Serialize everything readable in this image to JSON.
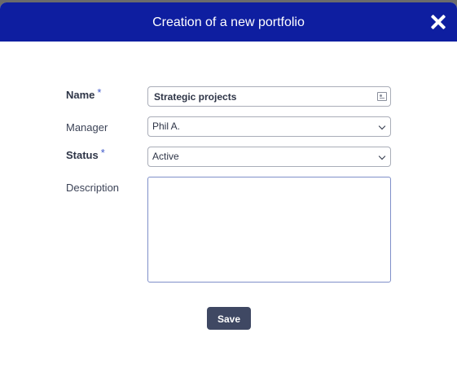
{
  "dialog": {
    "title": "Creation of a new portfolio",
    "close_icon": "close-icon"
  },
  "form": {
    "name": {
      "label": "Name",
      "required_marker": "*",
      "value": "Strategic projects",
      "icon": "id-card-icon"
    },
    "manager": {
      "label": "Manager",
      "selected": "Phil A."
    },
    "status": {
      "label": "Status",
      "required_marker": "*",
      "selected": "Active"
    },
    "description": {
      "label": "Description",
      "value": ""
    },
    "save_label": "Save"
  },
  "colors": {
    "header_bg": "#0e1ea0",
    "required_marker": "#3d57c8",
    "save_button_bg": "#3f4863"
  }
}
